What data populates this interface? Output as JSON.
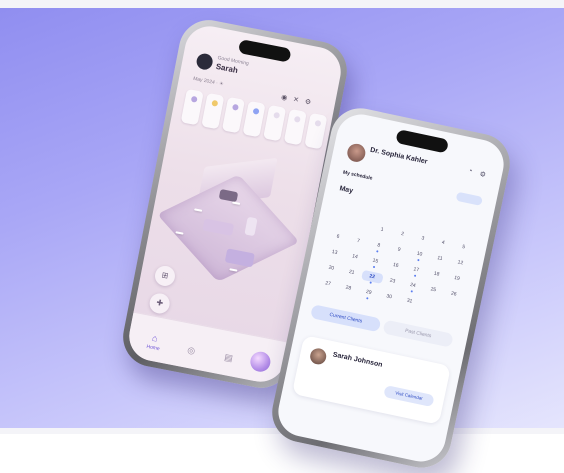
{
  "colors": {
    "background_top": "#8f8df0",
    "background_bottom": "#e6e6fd",
    "accent_purple": "#6d52d6",
    "accent_blue": "#5a7df0"
  },
  "home_app": {
    "greeting": "Good Morning",
    "user_name": "Sarah",
    "weather": "May 2024 · ☀",
    "header_icons": [
      "mic-icon",
      "tools-icon",
      "settings-icon"
    ],
    "device_chips": [
      "",
      "",
      "",
      "",
      "",
      "",
      ""
    ],
    "room_tags": [
      "",
      "",
      "",
      ""
    ],
    "controls": [
      "grid-icon",
      "plus-icon"
    ],
    "tabs": [
      {
        "label": "Home",
        "icon": "home-icon",
        "active": true
      },
      {
        "label": "",
        "icon": "devices-icon",
        "active": false
      },
      {
        "label": "",
        "icon": "stats-icon",
        "active": false
      }
    ]
  },
  "calendar_app": {
    "doctor_name": "Dr. Sophia Kahler",
    "doctor_role": "",
    "header_icons": [
      "chat-icon",
      "settings-icon"
    ],
    "schedule_label": "My schedule",
    "schedule_links": [
      "",
      ""
    ],
    "month": "May",
    "weekdays": [
      "",
      "",
      "",
      "",
      "",
      "",
      ""
    ],
    "days": [
      "",
      "",
      "1",
      "2",
      "3",
      "4",
      "5",
      "6",
      "7",
      "8",
      "9",
      "10",
      "11",
      "12",
      "13",
      "14",
      "15",
      "16",
      "17",
      "18",
      "19",
      "20",
      "21",
      "22",
      "23",
      "24",
      "25",
      "26",
      "27",
      "28",
      "29",
      "30",
      "31",
      "",
      ""
    ],
    "selected_day": "22",
    "tabs": [
      "Current Clients",
      "Past Clients"
    ],
    "filter": "",
    "client": {
      "name": "Sarah Johnson",
      "role": "",
      "link": "",
      "button": "Visit Calendar"
    }
  }
}
